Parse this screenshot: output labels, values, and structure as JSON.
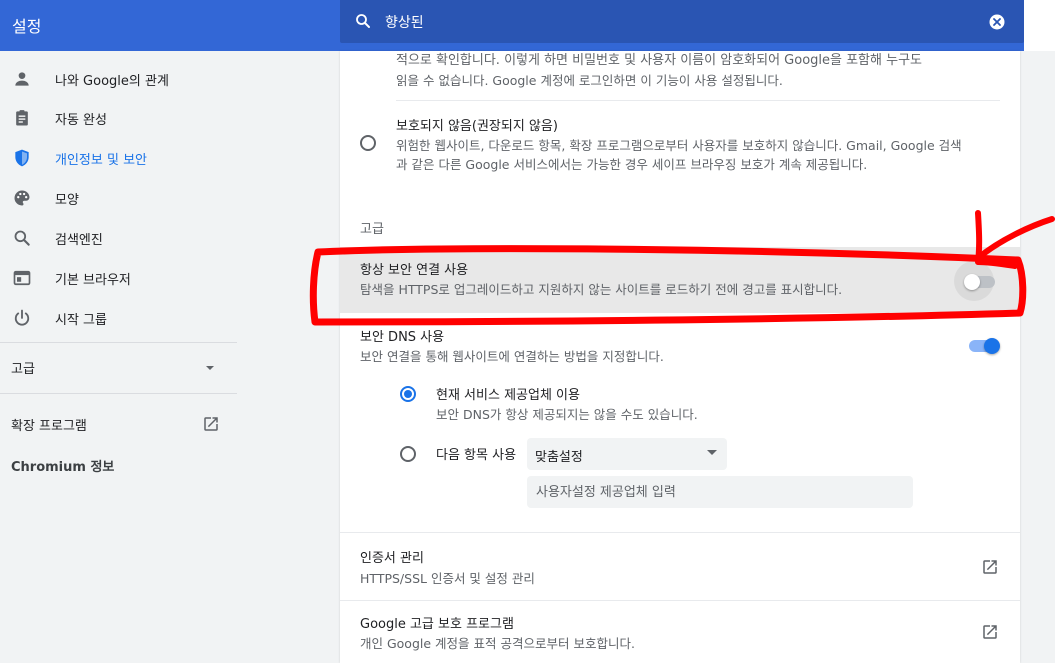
{
  "app": {
    "title": "설정"
  },
  "search": {
    "value": "향상된"
  },
  "sidebar": {
    "items": [
      {
        "label": "나와 Google의 관계",
        "icon": "person-icon"
      },
      {
        "label": "자동 완성",
        "icon": "clipboard-icon"
      },
      {
        "label": "개인정보 및 보안",
        "icon": "shield-icon",
        "active": true
      },
      {
        "label": "모양",
        "icon": "palette-icon"
      },
      {
        "label": "검색엔진",
        "icon": "search-icon"
      },
      {
        "label": "기본 브라우저",
        "icon": "browser-icon"
      },
      {
        "label": "시작 그룹",
        "icon": "power-icon"
      }
    ],
    "advanced": "고급",
    "extensions": "확장 프로그램",
    "about": "Chromium 정보"
  },
  "main": {
    "enhanced_tail": {
      "line1": "적으로 확인합니다. 이렇게 하면 비밀번호 및 사용자 이름이 암호화되어 Google을 포함해 누구도",
      "line2": "읽을 수 없습니다. Google 계정에 로그인하면 이 기능이 사용 설정됩니다."
    },
    "no_protection": {
      "title": "보호되지 않음(권장되지 않음)",
      "line1": "위험한 웹사이트, 다운로드 항목, 확장 프로그램으로부터 사용자를 보호하지 않습니다. Gmail, Google 검색",
      "line2": "과 같은 다른 Google 서비스에서는 가능한 경우 세이프 브라우징 보호가 계속 제공됩니다."
    },
    "advanced_header": "고급",
    "https_first": {
      "title": "항상 보안 연결 사용",
      "desc": "탐색을 HTTPS로 업그레이드하고 지원하지 않는 사이트를 로드하기 전에 경고를 표시합니다.",
      "enabled": false
    },
    "secure_dns": {
      "title": "보안 DNS 사용",
      "desc": "보안 연결을 통해 웹사이트에 연결하는 방법을 지정합니다.",
      "enabled": true,
      "current_provider": {
        "label": "현재 서비스 제공업체 이용",
        "desc": "보안 DNS가 항상 제공되지는 않을 수도 있습니다."
      },
      "custom": {
        "label": "다음 항목 사용",
        "select_value": "맞춤설정",
        "placeholder": "사용자설정 제공업체 입력"
      }
    },
    "certificates": {
      "title": "인증서 관리",
      "desc": "HTTPS/SSL 인증서 및 설정 관리"
    },
    "advanced_protection": {
      "title": "Google 고급 보호 프로그램",
      "desc": "개인 Google 계정을 표적 공격으로부터 보호합니다."
    }
  },
  "colors": {
    "header": "#3367d6",
    "accent": "#1a73e8",
    "annotation": "#ff0000"
  }
}
